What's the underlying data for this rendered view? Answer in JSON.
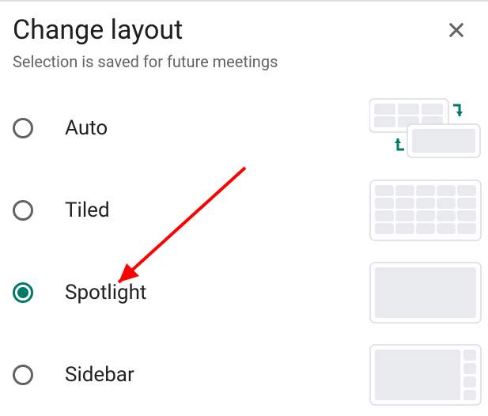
{
  "dialog": {
    "title": "Change layout",
    "subtitle": "Selection is saved for future meetings"
  },
  "options": [
    {
      "id": "auto",
      "label": "Auto",
      "selected": false
    },
    {
      "id": "tiled",
      "label": "Tiled",
      "selected": false
    },
    {
      "id": "spotlight",
      "label": "Spotlight",
      "selected": true
    },
    {
      "id": "sidebar",
      "label": "Sidebar",
      "selected": false
    }
  ],
  "colors": {
    "accent": "#00796b",
    "muted": "#5f6368",
    "cell": "#e8eaed",
    "cellBorder": "#dadce0"
  }
}
